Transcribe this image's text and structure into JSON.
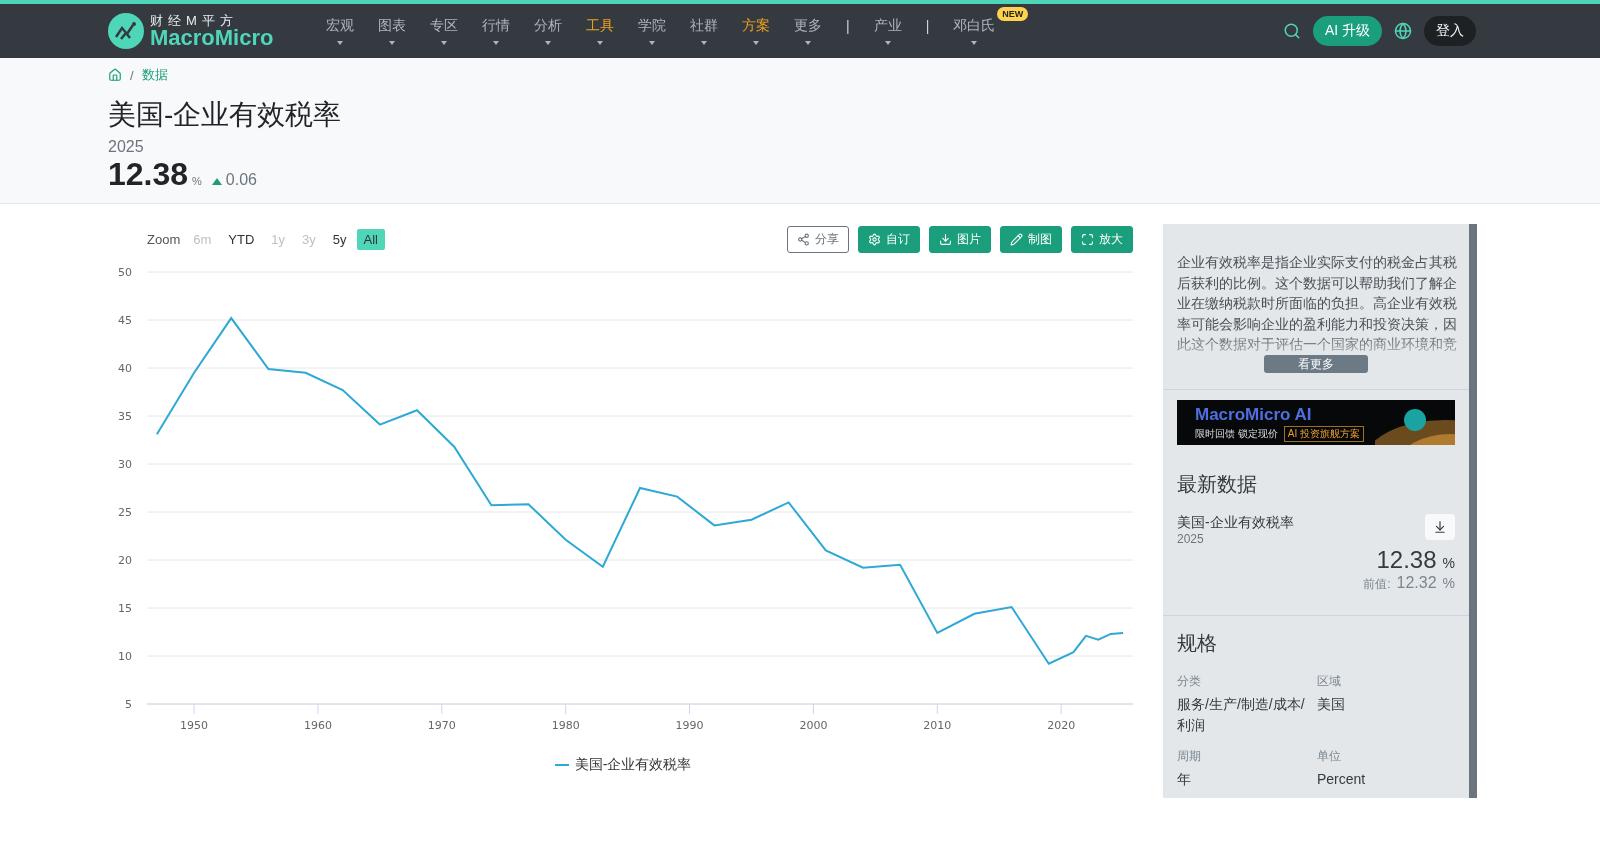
{
  "nav": {
    "logo": {
      "top": "财经M平方",
      "bottom": "MacroMicro"
    },
    "items": [
      {
        "kind": "menu",
        "label": "宏观",
        "highlighted": false
      },
      {
        "kind": "menu",
        "label": "图表",
        "highlighted": false
      },
      {
        "kind": "menu",
        "label": "专区",
        "highlighted": false
      },
      {
        "kind": "menu",
        "label": "行情",
        "highlighted": false
      },
      {
        "kind": "menu",
        "label": "分析",
        "highlighted": false
      },
      {
        "kind": "menu",
        "label": "工具",
        "highlighted": true
      },
      {
        "kind": "menu",
        "label": "学院",
        "highlighted": false
      },
      {
        "kind": "menu",
        "label": "社群",
        "highlighted": false
      },
      {
        "kind": "menu",
        "label": "方案",
        "highlighted": true
      },
      {
        "kind": "menu",
        "label": "更多",
        "highlighted": false
      },
      {
        "kind": "separator",
        "label": "|"
      },
      {
        "kind": "menu",
        "label": "产业",
        "highlighted": false
      },
      {
        "kind": "separator",
        "label": "|"
      },
      {
        "kind": "menu",
        "label": "邓白氏",
        "highlighted": false,
        "badge": "NEW"
      }
    ],
    "ai_button": "AI 升级",
    "login_button": "登入"
  },
  "breadcrumb": {
    "separator": "/",
    "items": [
      "数据"
    ]
  },
  "header": {
    "title": "美国-企业有效税率",
    "period": "2025",
    "value": "12.38",
    "unit": "%",
    "change": "0.06"
  },
  "chart": {
    "zoom_label": "Zoom",
    "ranges": [
      {
        "label": "6m",
        "selected": false,
        "disabled": true
      },
      {
        "label": "YTD",
        "selected": false,
        "disabled": false
      },
      {
        "label": "1y",
        "selected": false,
        "disabled": true
      },
      {
        "label": "3y",
        "selected": false,
        "disabled": true
      },
      {
        "label": "5y",
        "selected": false,
        "disabled": false
      },
      {
        "label": "All",
        "selected": true,
        "disabled": false
      }
    ],
    "actions": [
      {
        "kind": "share",
        "label": "分享"
      },
      {
        "kind": "settings",
        "label": "自订"
      },
      {
        "kind": "download",
        "label": "图片"
      },
      {
        "kind": "edit",
        "label": "制图"
      },
      {
        "kind": "expand",
        "label": "放大"
      }
    ],
    "chart_data": {
      "type": "line",
      "grid": true,
      "xlim": [
        1946.2,
        2025.8
      ],
      "ylim": [
        5,
        50
      ],
      "xticks": [
        1950,
        1960,
        1970,
        1980,
        1990,
        2000,
        2010,
        2020
      ],
      "yticks": [
        5,
        10,
        15,
        20,
        25,
        30,
        35,
        40,
        45,
        50
      ],
      "x": [
        1947,
        1950,
        1953,
        1956,
        1959,
        1962,
        1965,
        1968,
        1971,
        1974,
        1977,
        1980,
        1983,
        1986,
        1989,
        1992,
        1995,
        1998,
        2001,
        2004,
        2007,
        2010,
        2013,
        2016,
        2019,
        2021,
        2022,
        2023,
        2024,
        2025
      ],
      "series": [
        {
          "name": "美国-企业有效税率",
          "color": "#2ea8d6",
          "values": [
            33.1,
            39.5,
            45.2,
            39.9,
            39.5,
            37.7,
            34.1,
            35.6,
            31.8,
            25.7,
            25.8,
            22.1,
            19.3,
            27.5,
            26.6,
            23.6,
            24.2,
            26.0,
            21.0,
            19.2,
            19.5,
            12.4,
            14.4,
            15.1,
            9.2,
            10.4,
            12.1,
            11.7,
            12.3,
            12.4
          ]
        }
      ]
    }
  },
  "sidebar": {
    "description": "企业有效税率是指企业实际支付的税金占其税后获利的比例。这个数据可以帮助我们了解企业在缴纳税款时所面临的负担。高企业有效税率可能会影响企业的盈利能力和投资决策，因此这个数据对于评估一个国家的商业环境和竞",
    "more_button": "看更多",
    "banner": {
      "title": "MacroMicro AI",
      "tagline": "限时回馈 锁定现价",
      "cta": "AI 投资旗舰方案"
    },
    "latest": {
      "heading": "最新数据",
      "name": "美国-企业有效税率",
      "period": "2025",
      "value": "12.38",
      "unit": "%",
      "prev_label": "前值:",
      "prev_value": "12.32",
      "prev_unit": "%"
    },
    "specs": {
      "heading": "规格",
      "items": [
        {
          "label": "分类",
          "value": "服务/生产/制造/成本/利润"
        },
        {
          "label": "区域",
          "value": "美国"
        },
        {
          "label": "周期",
          "value": "年"
        },
        {
          "label": "单位",
          "value": "Percent"
        }
      ]
    }
  }
}
